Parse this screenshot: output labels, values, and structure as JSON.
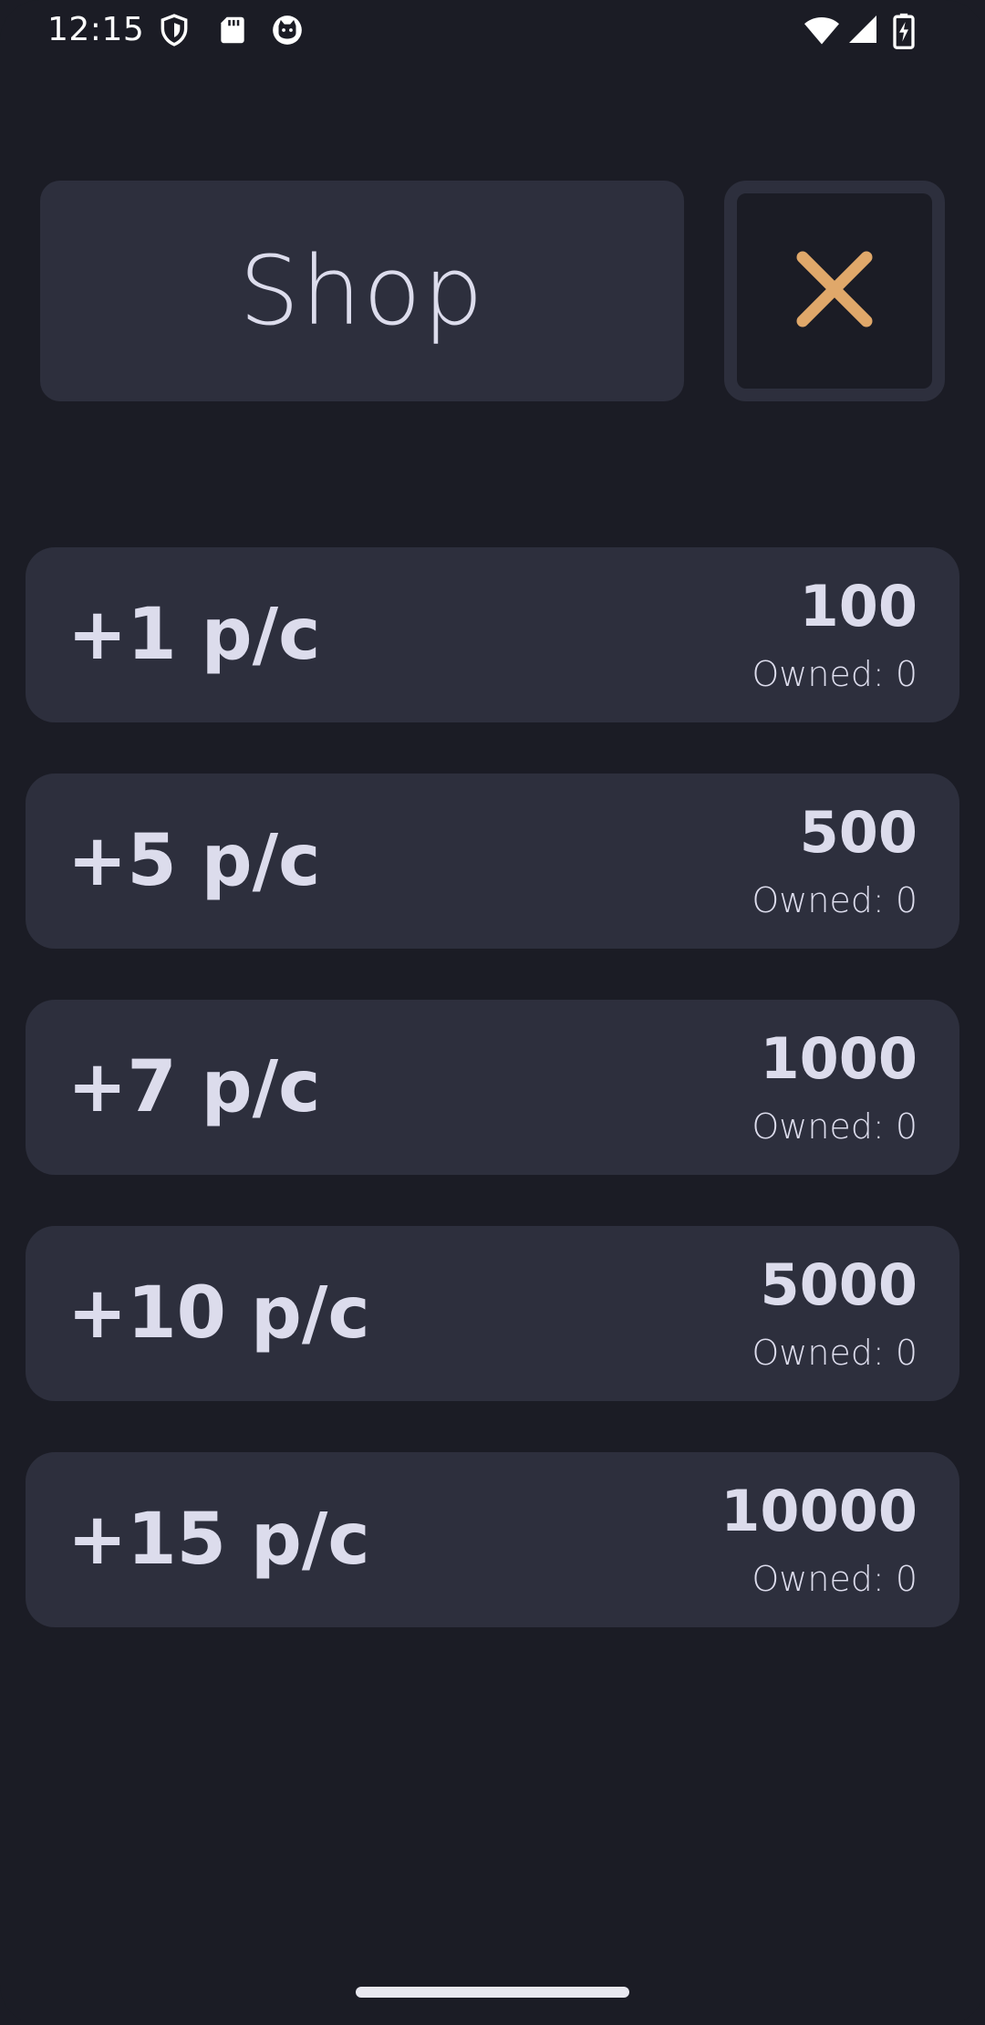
{
  "status_bar": {
    "time": "12:15",
    "icons": [
      "shield-icon",
      "sd-card-icon",
      "cat-face-icon",
      "wifi-icon",
      "cell-signal-icon",
      "battery-charging-icon"
    ]
  },
  "header": {
    "title": "Shop",
    "close_icon": "close-icon",
    "accent_color": "#e0a86a"
  },
  "items": [
    {
      "label": "+1 p/c",
      "price": "100",
      "owned": "Owned: 0"
    },
    {
      "label": "+5 p/c",
      "price": "500",
      "owned": "Owned: 0"
    },
    {
      "label": "+7 p/c",
      "price": "1000",
      "owned": "Owned: 0"
    },
    {
      "label": "+10 p/c",
      "price": "5000",
      "owned": "Owned: 0"
    },
    {
      "label": "+15 p/c",
      "price": "10000",
      "owned": "Owned: 0"
    }
  ],
  "colors": {
    "background": "#1b1c25",
    "card": "#2d2f3d",
    "text": "#dcdcec"
  }
}
